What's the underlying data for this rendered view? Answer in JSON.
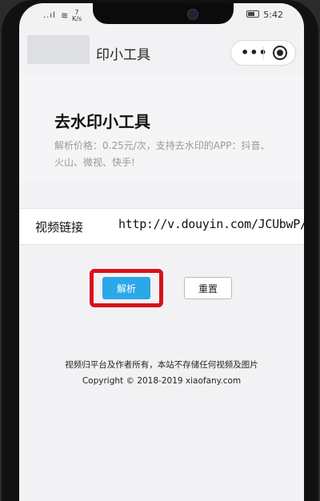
{
  "status_bar": {
    "signal": "..ıl",
    "wifi": "≋",
    "net_speed_top": "7",
    "net_speed_bottom": "K/s",
    "time": "5:42"
  },
  "navbar": {
    "title": "印小工具",
    "more_icon": "more-dots-icon",
    "close_icon": "miniprogram-close-icon"
  },
  "page": {
    "tool_title": "去水印小工具",
    "description": "解析价格：0.25元/次，支持去水印的APP：抖音、火山、微视、快手!",
    "link_label": "视频链接",
    "link_value": "http://v.douyin.com/JCUbwP/",
    "parse_button": "解析",
    "reset_button": "重置",
    "footer_notice": "视频归平台及作者所有，本站不存储任何视频及图片",
    "footer_copyright": "Copyright © 2018-2019 xiaofany.com"
  },
  "colors": {
    "primary_button": "#2aa8e8",
    "highlight_border": "#d9101a"
  }
}
